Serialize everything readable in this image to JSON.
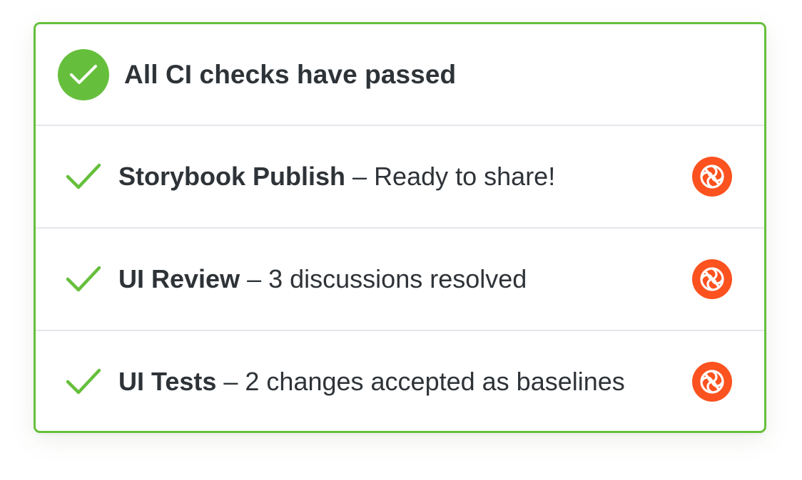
{
  "header": {
    "title": "All CI checks have passed",
    "status": "passed",
    "icon": "check-circle-icon",
    "accent_color": "#66bf3c"
  },
  "checks": [
    {
      "name": "Storybook Publish",
      "separator": " – ",
      "description": "Ready to share!",
      "status_icon": "check-icon",
      "app_icon": "chromatic-logo-icon"
    },
    {
      "name": "UI Review",
      "separator": " – ",
      "description": "3 discussions resolved",
      "status_icon": "check-icon",
      "app_icon": "chromatic-logo-icon"
    },
    {
      "name": "UI Tests",
      "separator": " – ",
      "description": "2 changes accepted as baselines",
      "status_icon": "check-icon",
      "app_icon": "chromatic-logo-icon"
    }
  ],
  "colors": {
    "success": "#66bf3c",
    "chromatic_brand": "#fc521f",
    "text": "#2e3338",
    "divider": "#e4e8ec"
  }
}
